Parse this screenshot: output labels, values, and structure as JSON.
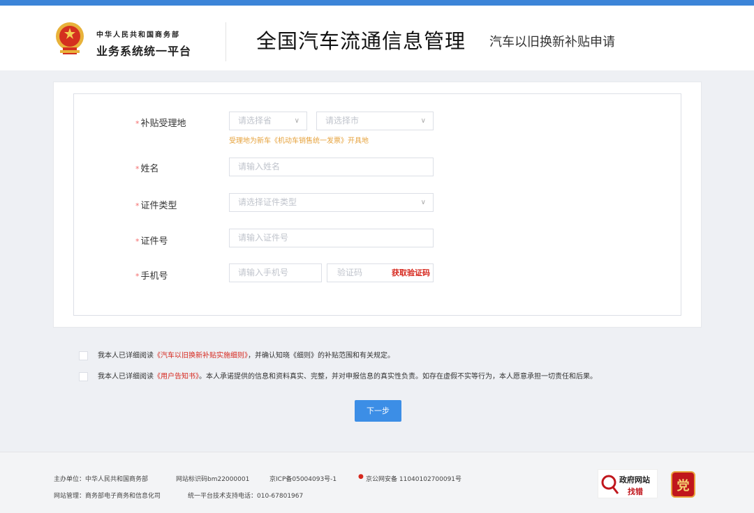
{
  "header": {
    "ministry_small": "中华人民共和国商务部",
    "ministry_big": "业务系统统一平台",
    "title": "全国汽车流通信息管理",
    "subtitle": "汽车以旧换新补贴申请"
  },
  "form": {
    "fields": [
      {
        "label": "补贴受理地",
        "province_placeholder": "请选择省",
        "city_placeholder": "请选择市",
        "hint": "受理地为新车《机动车销售统一发票》开具地"
      },
      {
        "label": "姓名",
        "placeholder": "请输入姓名"
      },
      {
        "label": "证件类型",
        "placeholder": "请选择证件类型"
      },
      {
        "label": "证件号",
        "placeholder": "请输入证件号"
      },
      {
        "label": "手机号",
        "placeholder": "请输入手机号",
        "code_placeholder": "验证码",
        "get_code": "获取验证码"
      }
    ]
  },
  "agreements": [
    {
      "prefix": "我本人已详细阅读",
      "link": "《汽车以旧换新补贴实施细则》",
      "suffix": "，并确认知晓《细则》的补贴范围和有关规定。"
    },
    {
      "prefix": "我本人已详细阅读",
      "link": "《用户告知书》",
      "suffix": "。本人承诺提供的信息和资料真实、完整，并对申报信息的真实性负责。如存在虚假不实等行为，本人愿意承担一切责任和后果。"
    }
  ],
  "next_button": "下一步",
  "footer": {
    "sponsor": "主办单位：中华人民共和国商务部",
    "site_id": "网站标识码bm22000001",
    "icp": "京ICP备05004093号-1",
    "police": "京公网安备 11040102700091号",
    "manager": "网站管理：商务部电子商务和信息化司",
    "support": "统一平台技术支持电话：010-67801967",
    "badge_gov_line1": "政府网站",
    "badge_gov_line2": "找错",
    "badge_party": "党"
  },
  "colors": {
    "accent": "#3c84d8",
    "required": "#f56c6c",
    "link": "#d6281e",
    "hint": "#e6a23c",
    "button": "#3c8ee6"
  }
}
